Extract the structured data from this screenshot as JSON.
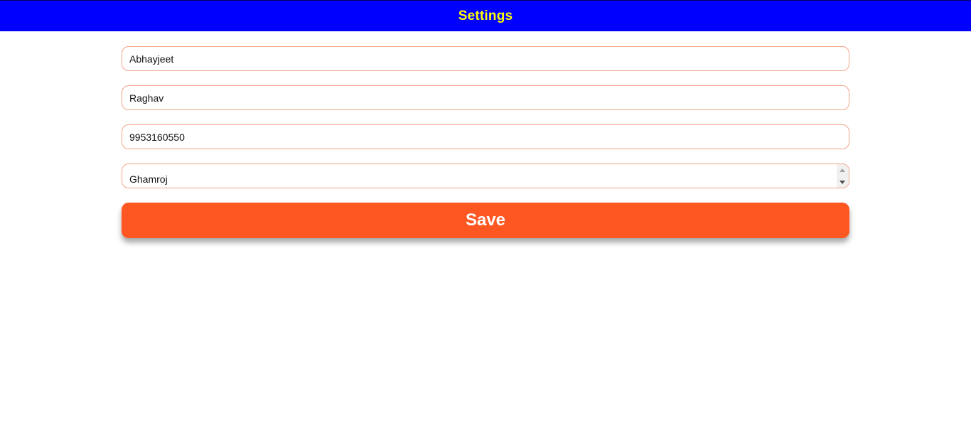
{
  "header": {
    "title": "Settings"
  },
  "form": {
    "first_name": "Abhayjeet",
    "last_name": "Raghav",
    "phone": "9953160550",
    "location_selected": "Ghamroj",
    "save_label": "Save"
  },
  "colors": {
    "header_bg": "#0000ff",
    "header_text": "#ffff00",
    "field_border": "#f4a58a",
    "save_bg": "#ff5722",
    "save_text": "#ffffff"
  }
}
